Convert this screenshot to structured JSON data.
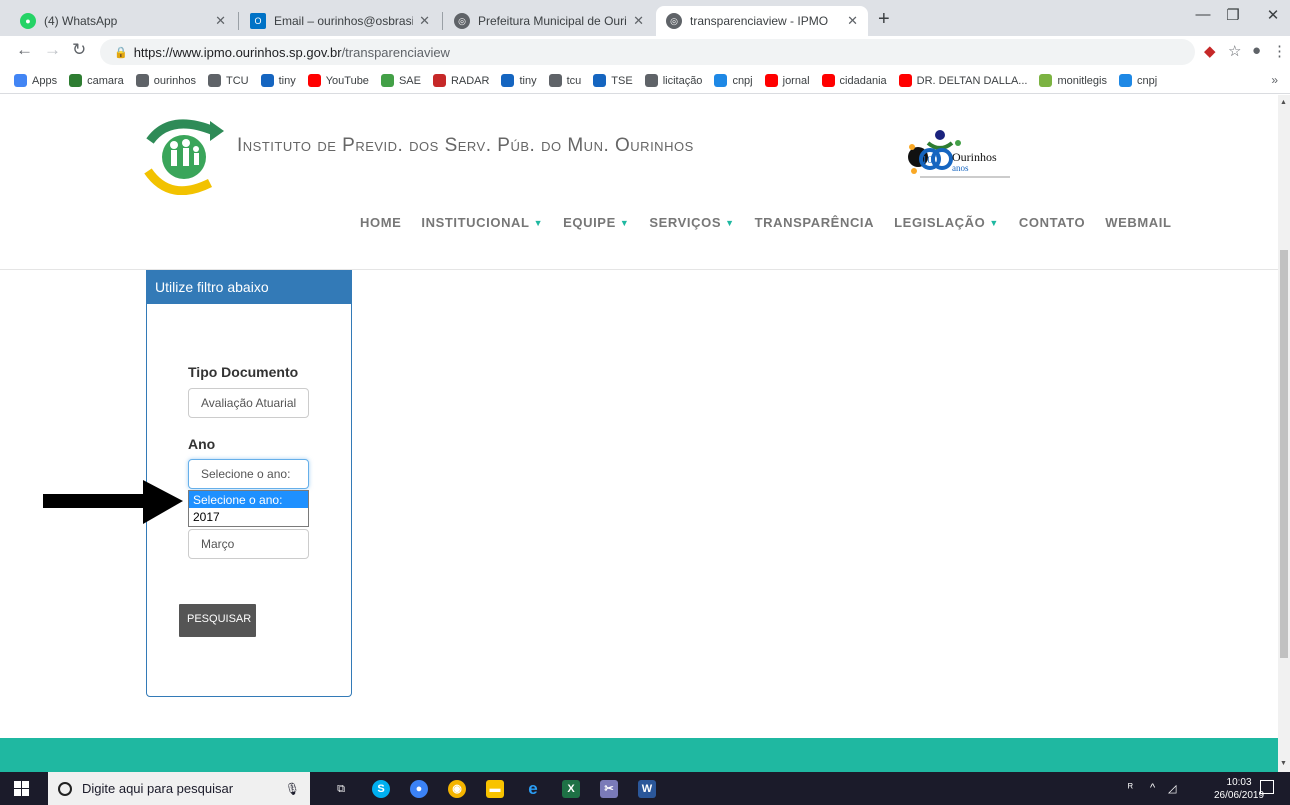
{
  "tabs": [
    {
      "title": "(4) WhatsApp",
      "icon": "whatsapp-icon",
      "active": false
    },
    {
      "title": "Email – ourinhos@osbrasil.org.br",
      "icon": "outlook-icon",
      "active": false
    },
    {
      "title": "Prefeitura Municipal de Ourinhos",
      "icon": "globe-icon",
      "active": false
    },
    {
      "title": "transparenciaview - IPMO",
      "icon": "globe-icon",
      "active": true
    }
  ],
  "address": {
    "host": "https://www.ipmo.ourinhos.sp.gov.br",
    "path": "/transparenciaview"
  },
  "bookmarks": [
    {
      "label": "Apps",
      "color": "#4285f4"
    },
    {
      "label": "camara",
      "color": "#2e7d32"
    },
    {
      "label": "ourinhos",
      "color": "#5f6368"
    },
    {
      "label": "TCU",
      "color": "#5f6368"
    },
    {
      "label": "tiny",
      "color": "#1565c0"
    },
    {
      "label": "YouTube",
      "color": "#ff0000"
    },
    {
      "label": "SAE",
      "color": "#43a047"
    },
    {
      "label": "RADAR",
      "color": "#c62828"
    },
    {
      "label": "tiny",
      "color": "#1565c0"
    },
    {
      "label": "tcu",
      "color": "#5f6368"
    },
    {
      "label": "TSE",
      "color": "#1565c0"
    },
    {
      "label": "licitação",
      "color": "#5f6368"
    },
    {
      "label": "cnpj",
      "color": "#1e88e5"
    },
    {
      "label": "jornal",
      "color": "#ff0000"
    },
    {
      "label": "cidadania",
      "color": "#ff0000"
    },
    {
      "label": "DR. DELTAN DALLA...",
      "color": "#ff0000"
    },
    {
      "label": "monitlegis",
      "color": "#7cb342"
    },
    {
      "label": "cnpj",
      "color": "#1e88e5"
    }
  ],
  "site": {
    "title_parts": [
      "I",
      "NSTITUTO DE ",
      "P",
      "REVID. DOS ",
      "S",
      "ERV. ",
      "P",
      "ÚB. DO ",
      "M",
      "UN. ",
      "O",
      "URINHOS"
    ],
    "title": "Instituto de Previd. dos Serv. Púb. do Mun. Ourinhos",
    "anniv_text": "Ourinhos",
    "anniv_number": "100",
    "anniv_sub": "anos",
    "nav": [
      {
        "label": "HOME",
        "dropdown": false
      },
      {
        "label": "INSTITUCIONAL",
        "dropdown": true
      },
      {
        "label": "EQUIPE",
        "dropdown": true
      },
      {
        "label": "SERVIÇOS",
        "dropdown": true
      },
      {
        "label": "TRANSPARÊNCIA",
        "dropdown": false
      },
      {
        "label": "LEGISLAÇÃO",
        "dropdown": true
      },
      {
        "label": "CONTATO",
        "dropdown": false
      },
      {
        "label": "WEBMAIL",
        "dropdown": false
      }
    ]
  },
  "filter": {
    "heading": "Utilize filtro abaixo",
    "tipo_label": "Tipo Documento",
    "tipo_value": "Avaliação Atuarial",
    "ano_label": "Ano",
    "ano_value": "Selecione o ano:",
    "ano_options": [
      "Selecione o ano:",
      "2017"
    ],
    "mes_value": "Março",
    "button": "PESQUISAR"
  },
  "taskbar": {
    "search_placeholder": "Digite aqui para pesquisar",
    "time": "10:03",
    "date": "26/06/2019"
  },
  "colors": {
    "brand_teal": "#1fb8a1",
    "panel_blue": "#337ab7",
    "selected_option": "#1e90ff"
  }
}
